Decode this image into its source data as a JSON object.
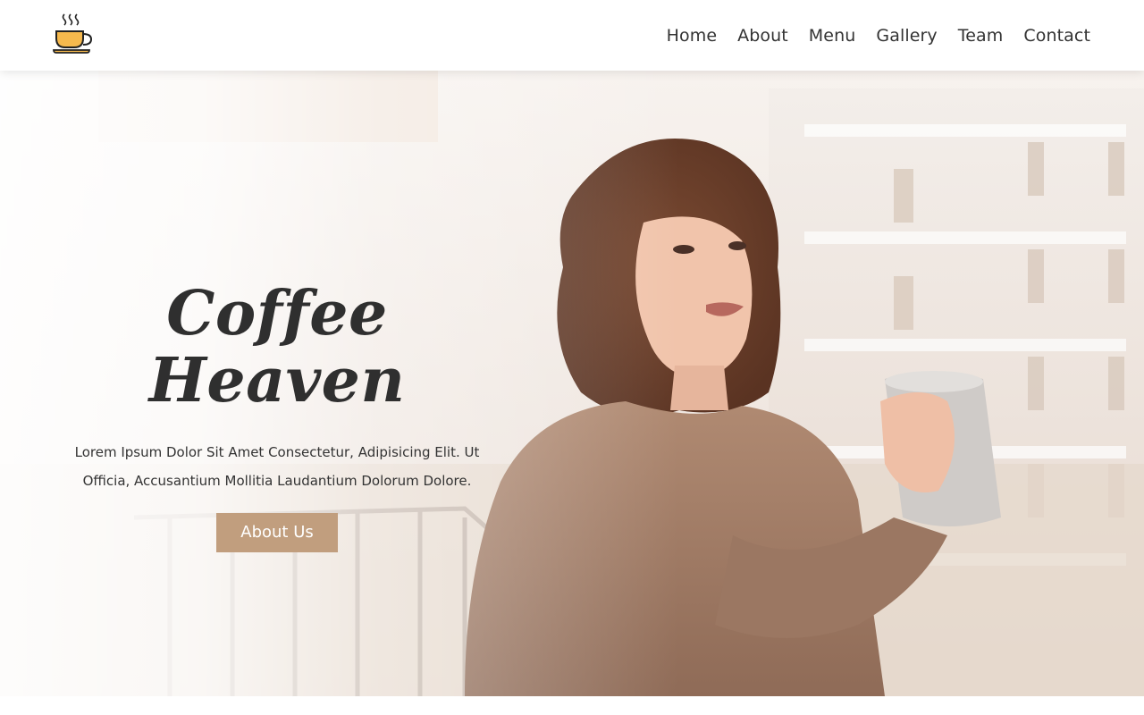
{
  "header": {
    "logo_icon": "coffee-cup-icon",
    "nav": [
      {
        "label": "Home"
      },
      {
        "label": "About"
      },
      {
        "label": "Menu"
      },
      {
        "label": "Gallery"
      },
      {
        "label": "Team"
      },
      {
        "label": "Contact"
      }
    ]
  },
  "hero": {
    "title": "Coffee Heaven",
    "text": "Lorem Ipsum Dolor Sit Amet Consectetur, Adipisicing Elit. Ut Officia, Accusantium Mollitia Laudantium Dolorum Dolore.",
    "button_label": "About Us",
    "background_image": "woman-holding-coffee-mug-on-balcony-photo"
  },
  "colors": {
    "accent": "#c19e7e",
    "text": "#333333",
    "header_bg": "#ffffff"
  }
}
